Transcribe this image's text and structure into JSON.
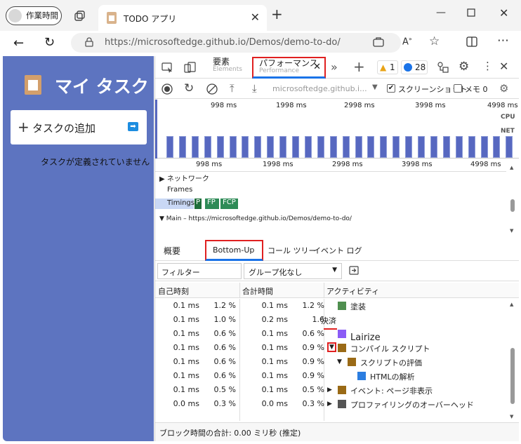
{
  "browser": {
    "profile_label": "作業時間",
    "tab_title": "TODO アプリ",
    "url": "https://microsoftedge.github.io/Demos/demo-to-do/"
  },
  "app": {
    "title": "マイ タスク",
    "add_task": "タスクの追加",
    "empty_message": "タスクが定義されていません"
  },
  "devtools": {
    "tab_elements": "要素",
    "tab_elements_under": "Elements",
    "tab_performance": "パフォーマンス",
    "tab_performance_under": "Performance",
    "warn_count": "1",
    "msg_count": "28",
    "recording_url": "microsoftedge.github.i...",
    "screenshot_label": "スクリーンショット",
    "memory_label": "メモ 0",
    "ruler_ticks": [
      "998 ms",
      "1998 ms",
      "2998 ms",
      "3998 ms",
      "4998 ms"
    ],
    "cpu_label": "CPU",
    "net_label": "NET",
    "track_network": "ネットワーク",
    "track_frames": "Frames",
    "track_timings": "Timings",
    "timing_markers": [
      "P",
      "FP",
      "FCP"
    ],
    "track_main": "Main – https://microsoftedge.github.io/Demos/demo-to-do/",
    "bottom_tabs": [
      "概要",
      "Bottom-Up",
      "コール ツリー",
      "イベント ログ"
    ],
    "filter_placeholder": "フィルター",
    "group_select": "グループ化なし",
    "col_self": "自己時刻",
    "col_total": "合計時間",
    "col_activity": "アクティビティ",
    "rows": [
      {
        "self": "0.1 ms",
        "self_pct": "1.2 %",
        "total": "0.1 ms",
        "total_pct": "1.2 %",
        "activity": "塗装",
        "color": "#4f8f4f",
        "indent": 0,
        "arrow": ""
      },
      {
        "self": "0.1 ms",
        "self_pct": "1.0 %",
        "total": "0.2 ms",
        "total_pct": "1.6",
        "activity": "決済",
        "color": "",
        "indent": 0,
        "arrow": ""
      },
      {
        "self": "0.1 ms",
        "self_pct": "0.6 %",
        "total": "0.1 ms",
        "total_pct": "0.6 %",
        "activity": "Lairize",
        "color": "#8b5cf6",
        "indent": 0,
        "arrow": ""
      },
      {
        "self": "0.1 ms",
        "self_pct": "0.6 %",
        "total": "0.1 ms",
        "total_pct": "0.9 %",
        "activity": "コンパイル スクリプト",
        "color": "#9a6a16",
        "indent": 0,
        "arrow": "▼"
      },
      {
        "self": "0.1 ms",
        "self_pct": "0.6 %",
        "total": "0.1 ms",
        "total_pct": "0.9 %",
        "activity": "スクリプトの評価",
        "color": "#9a6a16",
        "indent": 1,
        "arrow": "▼"
      },
      {
        "self": "0.1 ms",
        "self_pct": "0.6 %",
        "total": "0.1 ms",
        "total_pct": "0.9 %",
        "activity": "HTMLの解析",
        "color": "#2b7de0",
        "indent": 2,
        "arrow": ""
      },
      {
        "self": "0.1 ms",
        "self_pct": "0.5 %",
        "total": "0.1 ms",
        "total_pct": "0.5 %",
        "activity": "イベント: ページ非表示",
        "color": "#9a6a16",
        "indent": 0,
        "arrow": "▶"
      },
      {
        "self": "0.0 ms",
        "self_pct": "0.3 %",
        "total": "0.0 ms",
        "total_pct": "0.3 %",
        "activity": "プロファイリングのオーバーヘッド",
        "color": "#555555",
        "indent": 0,
        "arrow": "▶"
      }
    ],
    "status": "ブロック時間の合計: 0.00 ミリ秒 (推定)"
  }
}
